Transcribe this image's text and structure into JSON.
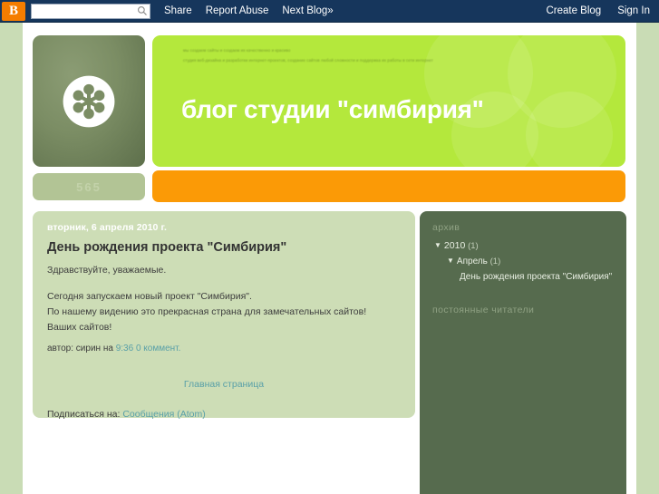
{
  "navbar": {
    "logo_letter": "B",
    "search_placeholder": "",
    "search_value": "",
    "search_icon": "search-icon",
    "links": [
      {
        "label": "Share"
      },
      {
        "label": "Report Abuse"
      },
      {
        "label": "Next Blog»"
      }
    ],
    "right_links": [
      {
        "label": "Create Blog"
      },
      {
        "label": "Sign In"
      }
    ]
  },
  "header": {
    "logo_alt": "flower-logo",
    "title": "блог студии \"симбирия\"",
    "description_line1": "мы создаем сайты и создаем их качественно и красиво",
    "description_line2": "студия веб-дизайна и разработки интернет-проектов, создание сайтов любой сложности и поддержка их работы в сети интернет",
    "counter": "565",
    "accent_green": "#b4e83c",
    "accent_orange": "#fb9a06",
    "sidebar_green": "#566b4e",
    "post_green": "#cdddb6",
    "page_green": "#c9dcb5"
  },
  "post": {
    "date": "вторник, 6 апреля 2010 г.",
    "title": "День рождения проекта \"Симбирия\"",
    "body_line1": "Здравствуйте, уважаемые.",
    "body_line2": "Сегодня запускаем новый проект \"Симбирия\".",
    "body_line3": "По нашему видению это прекрасная страна для замечательных сайтов!",
    "body_line4": "Ваших сайтов!",
    "footer_author": "автор: сирин на",
    "footer_time": "9:36",
    "footer_comments": "0 коммент.",
    "home_link": "Главная страница",
    "subscribe_label": "Подписаться на:",
    "subscribe_link": "Сообщения (Atom)"
  },
  "sidebar": {
    "archive_heading": "архив",
    "year_label": "2010",
    "year_count": "(1)",
    "month_label": "Апрель",
    "month_count": "(1)",
    "post_link": "День рождения проекта \"Симбирия\"",
    "triangle_glyph": "▼",
    "followers_heading": "постоянные читатели"
  }
}
